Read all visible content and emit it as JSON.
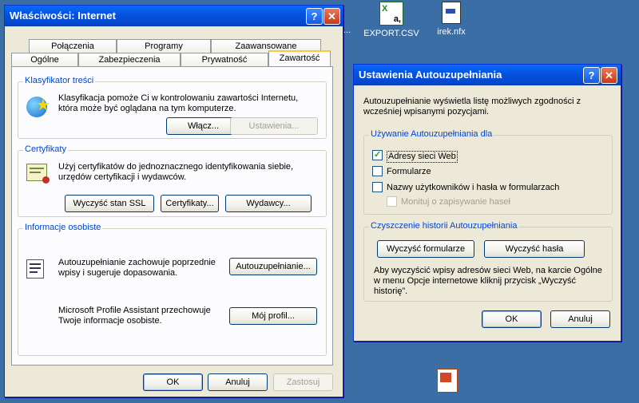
{
  "desktop": {
    "icons": [
      {
        "label": "EXPORT.CSV",
        "glyph": "a,"
      },
      {
        "label": "irek.nfx",
        "glyph": ""
      }
    ],
    "fragment_dots": "..."
  },
  "internet_props": {
    "title": "Właściwości: Internet",
    "help_glyph": "?",
    "close_glyph": "✕",
    "tabs_back": [
      "Połączenia",
      "Programy",
      "Zaawansowane"
    ],
    "tabs_front": [
      "Ogólne",
      "Zabezpieczenia",
      "Prywatność",
      "Zawartość"
    ],
    "classifier": {
      "label": "Klasyfikator treści",
      "text": "Klasyfikacja pomoże Ci w kontrolowaniu zawartości Internetu, która może być oglądana na tym komputerze.",
      "enable_btn": "Włącz...",
      "settings_btn": "Ustawienia..."
    },
    "certificates": {
      "label": "Certyfikaty",
      "text": "Użyj certyfikatów do jednoznacznego identyfikowania siebie, urzędów certyfikacji i wydawców.",
      "clear_ssl_btn": "Wyczyść stan SSL",
      "certs_btn": "Certyfikaty...",
      "publishers_btn": "Wydawcy..."
    },
    "personal": {
      "label": "Informacje osobiste",
      "autocomplete_text": "Autouzupełnianie zachowuje poprzednie wpisy i sugeruje dopasowania.",
      "autocomplete_btn": "Autouzupełnianie...",
      "profile_text": "Microsoft Profile Assistant przechowuje Twoje informacje osobiste.",
      "profile_btn": "Mój profil..."
    },
    "ok_btn": "OK",
    "cancel_btn": "Anuluj",
    "apply_btn": "Zastosuj"
  },
  "autocomplete": {
    "title": "Ustawienia Autouzupełniania",
    "help_glyph": "?",
    "close_glyph": "✕",
    "intro": "Autouzupełnianie wyświetla listę możliwych zgodności z wcześniej wpisanymi pozycjami.",
    "use_group": {
      "label": "Używanie Autouzupełniania dla",
      "web_addresses": "Adresy sieci Web",
      "forms": "Formularze",
      "usernames": "Nazwy użytkowników i hasła w formularzach",
      "prompt": "Monituj o zapisywanie haseł"
    },
    "clear_group": {
      "label": "Czyszczenie historii Autouzupełniania",
      "clear_forms_btn": "Wyczyść formularze",
      "clear_passwords_btn": "Wyczyść hasła",
      "note": "Aby wyczyścić wpisy adresów sieci Web, na karcie Ogólne w menu Opcje internetowe kliknij przycisk „Wyczyść historię”."
    },
    "ok_btn": "OK",
    "cancel_btn": "Anuluj"
  }
}
